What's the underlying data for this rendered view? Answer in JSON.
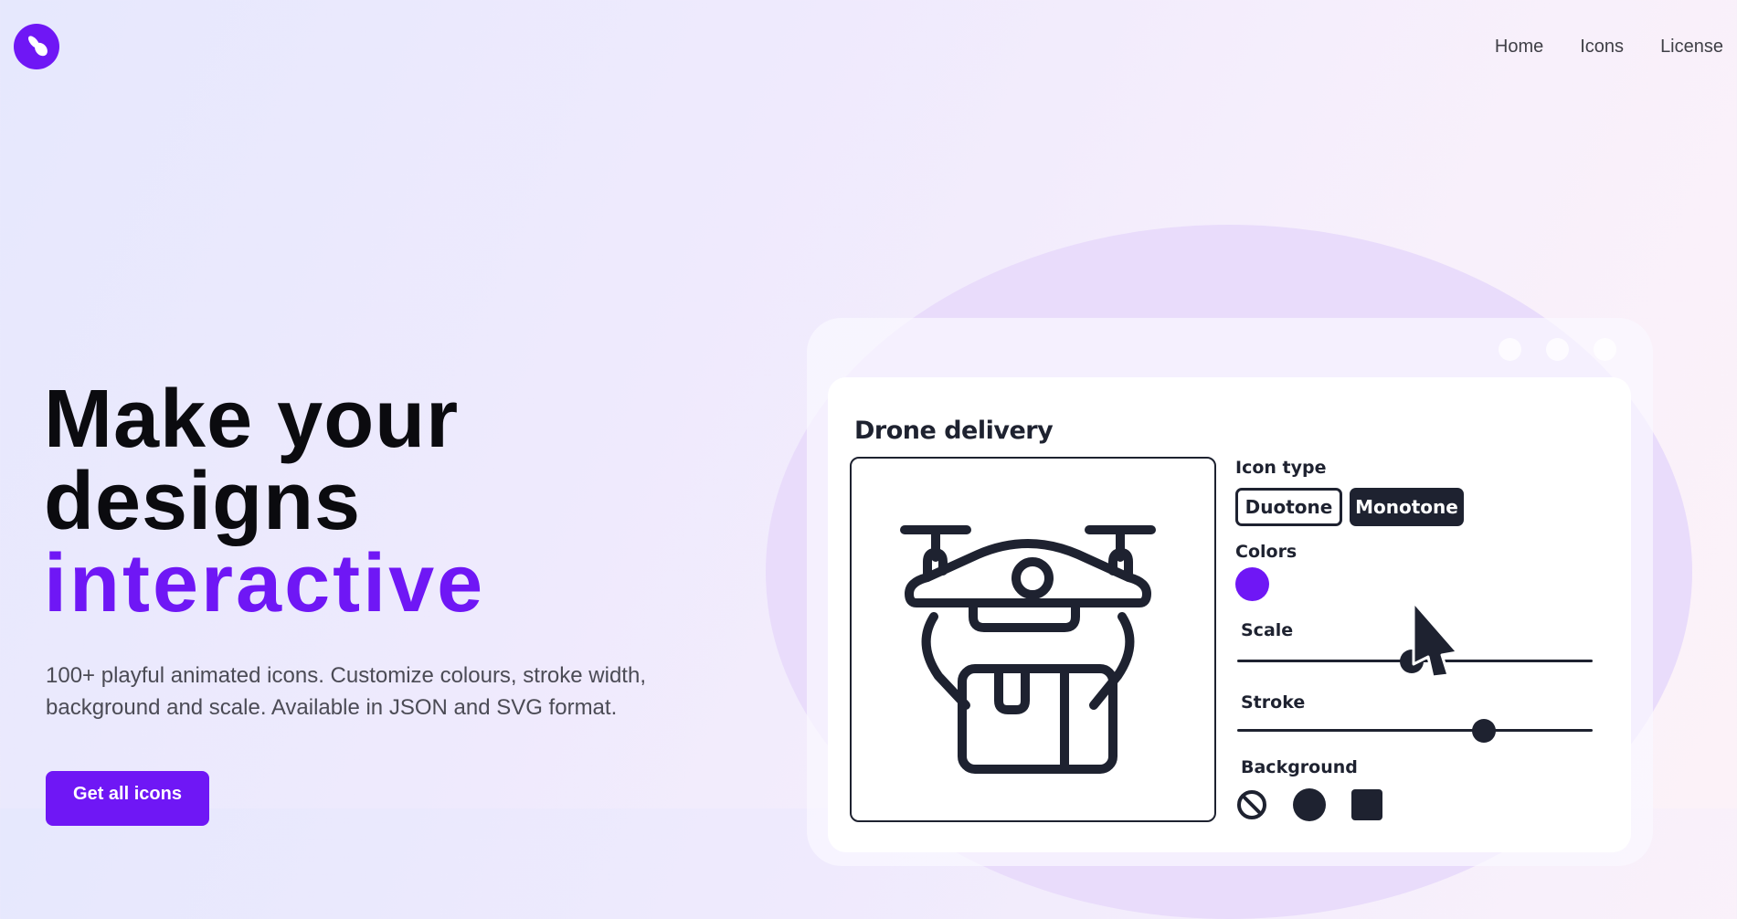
{
  "nav": {
    "items": [
      "Home",
      "Icons",
      "License"
    ]
  },
  "hero": {
    "title_line1": "Make your",
    "title_line2": "designs",
    "title_accent": "interactive",
    "description": "100+ playful animated icons. Customize colours, stroke width, background and scale. Available in JSON and SVG format.",
    "cta_label": "Get all icons"
  },
  "editor": {
    "icon_name": "Drone delivery",
    "icon_type_label": "Icon type",
    "icon_types": [
      "Duotone",
      "Monotone"
    ],
    "selected_icon_type": "Monotone",
    "colors_label": "Colors",
    "color": "#6f17f5",
    "scale_label": "Scale",
    "scale_value": 0.49,
    "stroke_label": "Stroke",
    "stroke_value": 0.7,
    "background_label": "Background",
    "background_options": [
      "none-icon",
      "circle-icon",
      "square-icon"
    ]
  },
  "colors": {
    "accent": "#6f17f5",
    "dark": "#1e2230"
  }
}
